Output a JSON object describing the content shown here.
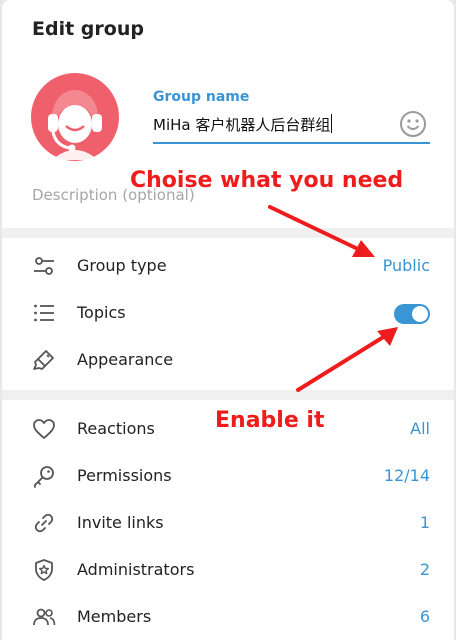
{
  "dialog": {
    "title": "Edit group",
    "group_name_label": "Group name",
    "group_name_value": "MiHa 客户机器人后台群组",
    "description_placeholder": "Description (optional)"
  },
  "settings": {
    "group_type": {
      "label": "Group type",
      "value": "Public"
    },
    "topics": {
      "label": "Topics",
      "enabled": true
    },
    "appearance": {
      "label": "Appearance"
    }
  },
  "management": [
    {
      "label": "Reactions",
      "value": "All",
      "icon": "heart-icon"
    },
    {
      "label": "Permissions",
      "value": "12/14",
      "icon": "key-icon"
    },
    {
      "label": "Invite links",
      "value": "1",
      "icon": "link-icon"
    },
    {
      "label": "Administrators",
      "value": "2",
      "icon": "shield-star-icon"
    },
    {
      "label": "Members",
      "value": "6",
      "icon": "members-icon"
    }
  ],
  "annotations": {
    "top": "Choise what you need",
    "bottom": "Enable it",
    "color": "#ee1c1c"
  },
  "colors": {
    "accent": "#3a95d5",
    "avatar": "#f0606c"
  }
}
